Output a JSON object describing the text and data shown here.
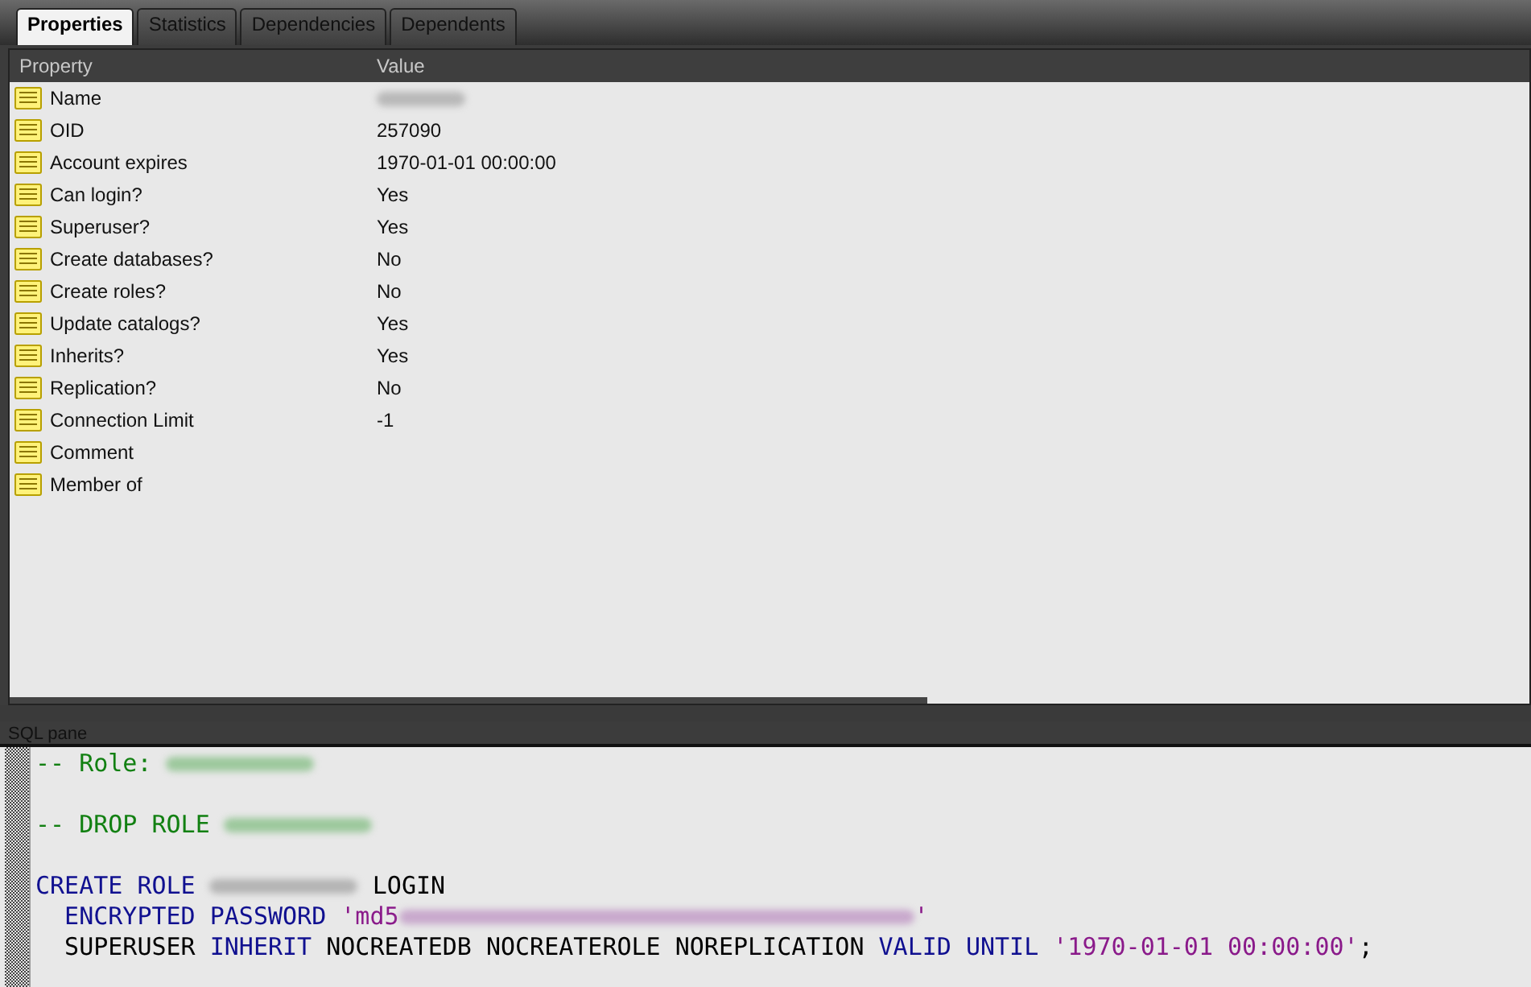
{
  "tabs": [
    {
      "label": "Properties",
      "selected": true
    },
    {
      "label": "Statistics",
      "selected": false
    },
    {
      "label": "Dependencies",
      "selected": false
    },
    {
      "label": "Dependents",
      "selected": false
    }
  ],
  "properties": {
    "columns": [
      "Property",
      "Value"
    ],
    "rows": [
      {
        "name": "Name",
        "kind": "redacted"
      },
      {
        "name": "OID",
        "value": "257090",
        "kind": "text"
      },
      {
        "name": "Account expires",
        "value": "1970-01-01 00:00:00",
        "kind": "text"
      },
      {
        "name": "Can login?",
        "value": "Yes",
        "kind": "text"
      },
      {
        "name": "Superuser?",
        "value": "Yes",
        "kind": "text"
      },
      {
        "name": "Create databases?",
        "value": "No",
        "kind": "text"
      },
      {
        "name": "Create roles?",
        "value": "No",
        "kind": "text"
      },
      {
        "name": "Update catalogs?",
        "value": "Yes",
        "kind": "text"
      },
      {
        "name": "Inherits?",
        "value": "Yes",
        "kind": "text"
      },
      {
        "name": "Replication?",
        "value": "No",
        "kind": "text"
      },
      {
        "name": "Connection Limit",
        "value": "-1",
        "kind": "text"
      },
      {
        "name": "Comment",
        "kind": "text"
      },
      {
        "name": "Member of",
        "kind": "text"
      }
    ]
  },
  "sql_pane": {
    "title": "SQL pane",
    "lines": [
      {
        "blank_before": false,
        "indent": false,
        "tokens": [
          {
            "kind": "comment",
            "text": "-- Role: "
          },
          {
            "kind": "redacted_short"
          }
        ]
      },
      {
        "blank_before": true,
        "indent": false,
        "tokens": [
          {
            "kind": "comment",
            "text": "-- DROP ROLE "
          },
          {
            "kind": "redacted_short"
          }
        ]
      },
      {
        "blank_before": true,
        "indent": false,
        "tokens": [
          {
            "kind": "keyword",
            "text": "CREATE ROLE "
          },
          {
            "kind": "redacted_short"
          },
          {
            "kind": "plain",
            "text": " LOGIN"
          }
        ]
      },
      {
        "blank_before": false,
        "indent": true,
        "tokens": [
          {
            "kind": "keyword",
            "text": "ENCRYPTED PASSWORD "
          },
          {
            "kind": "string",
            "text": "'md5"
          },
          {
            "kind": "redacted_long"
          },
          {
            "kind": "string",
            "text": "'"
          }
        ]
      },
      {
        "blank_before": false,
        "indent": true,
        "tokens": [
          {
            "kind": "plain",
            "text": "SUPERUSER "
          },
          {
            "kind": "keyword",
            "text": "INHERIT "
          },
          {
            "kind": "plain",
            "text": "NOCREATEDB NOCREATEROLE NOREPLICATION "
          },
          {
            "kind": "keyword",
            "text": "VALID UNTIL "
          },
          {
            "kind": "string",
            "text": "'1970-01-01 00:00:00'"
          },
          {
            "kind": "plain",
            "text": ";"
          }
        ]
      }
    ]
  }
}
